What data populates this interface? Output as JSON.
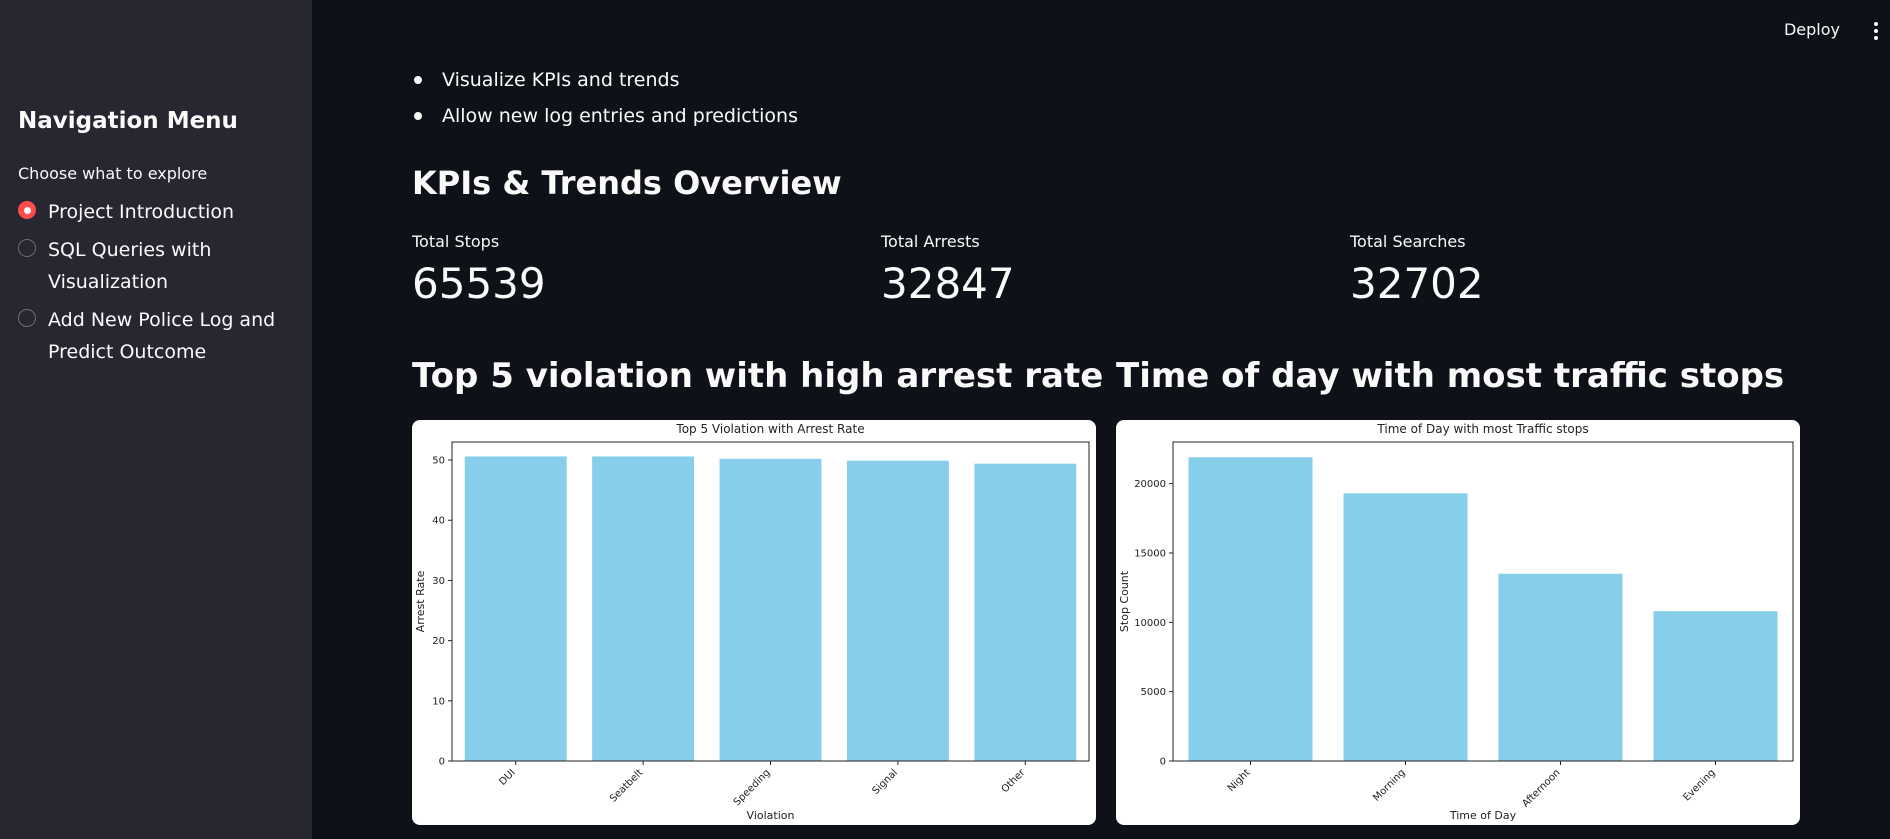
{
  "header": {
    "deploy_label": "Deploy",
    "more_icon": "vertical-ellipsis-icon"
  },
  "sidebar": {
    "title": "Navigation Menu",
    "caption": "Choose what to explore",
    "options": [
      {
        "label": "Project Introduction",
        "selected": true
      },
      {
        "label": "SQL Queries with Visualization",
        "selected": false
      },
      {
        "label": "Add New Police Log and Predict Outcome",
        "selected": false
      }
    ]
  },
  "main": {
    "bullets": [
      "Visualize KPIs and trends",
      "Allow new log entries and predictions"
    ],
    "section_title": "KPIs & Trends Overview",
    "kpis": [
      {
        "label": "Total Stops",
        "value": "65539"
      },
      {
        "label": "Total Arrests",
        "value": "32847"
      },
      {
        "label": "Total Searches",
        "value": "32702"
      }
    ],
    "chart_headings": [
      "Top 5 violation with high arrest rate",
      "Time of day with most traffic stops"
    ]
  },
  "colors": {
    "accent": "#ff4b4b",
    "bar": "#87ceeb",
    "background": "#0e1117",
    "sidebar": "#262730"
  },
  "chart_data": [
    {
      "type": "bar",
      "title": "Top 5 Violation with Arrest Rate",
      "xlabel": "Violation",
      "ylabel": "Arrest Rate",
      "categories": [
        "DUI",
        "Seatbelt",
        "Speeding",
        "Signal",
        "Other"
      ],
      "values": [
        50.6,
        50.6,
        50.2,
        49.9,
        49.4
      ],
      "ylim": [
        0,
        53
      ],
      "yticks": [
        0,
        10,
        20,
        30,
        40,
        50
      ],
      "grid": false
    },
    {
      "type": "bar",
      "title": "Time of Day with most Traffic stops",
      "xlabel": "Time of Day",
      "ylabel": "Stop Count",
      "categories": [
        "Night",
        "Morning",
        "Afternoon",
        "Evening"
      ],
      "values": [
        21900,
        19300,
        13500,
        10800
      ],
      "ylim": [
        0,
        23000
      ],
      "yticks": [
        0,
        5000,
        10000,
        15000,
        20000
      ],
      "grid": false
    }
  ]
}
